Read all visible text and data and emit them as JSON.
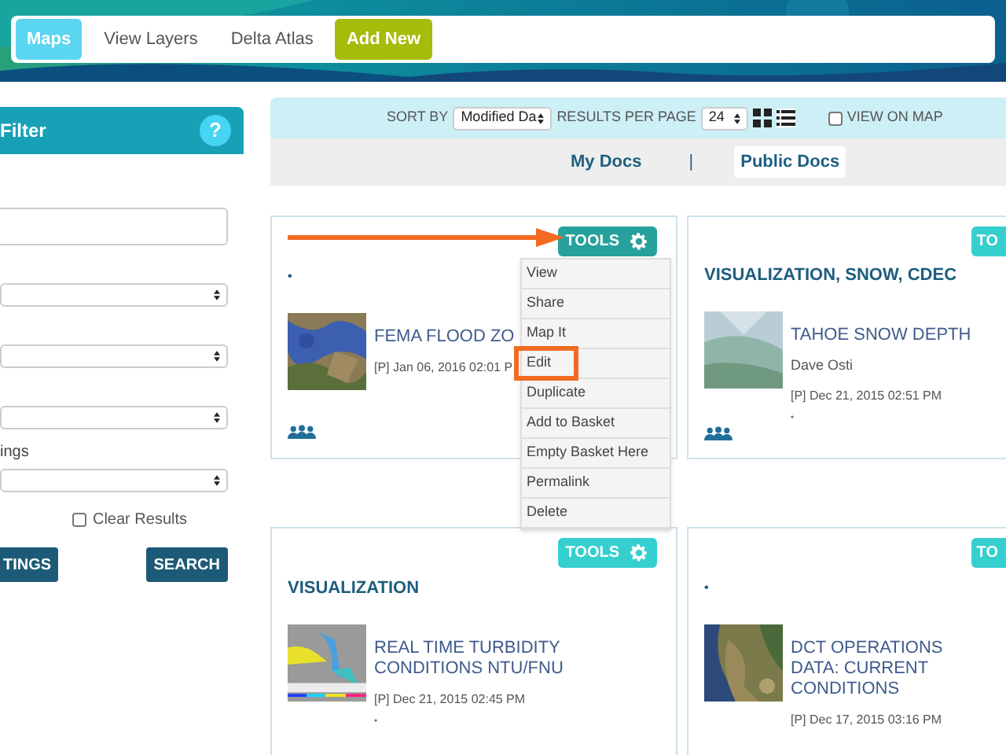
{
  "nav": [
    {
      "label": "Maps",
      "kind": "tab",
      "selected": true
    },
    {
      "label": "View Layers",
      "kind": "tab",
      "selected": false
    },
    {
      "label": "Delta Atlas",
      "kind": "tab",
      "selected": false
    },
    {
      "label": "Add New",
      "kind": "action",
      "selected": false
    }
  ],
  "filter": {
    "title": "Filter",
    "help": "?",
    "fields": [
      {
        "kind": "input"
      },
      {
        "kind": "select"
      },
      {
        "kind": "select"
      },
      {
        "kind": "select"
      },
      {
        "kind": "label",
        "text": "ings"
      },
      {
        "kind": "select"
      }
    ],
    "clear_results": {
      "label": "Clear Results",
      "checked": false
    },
    "buttons": [
      "TINGS",
      "SEARCH"
    ]
  },
  "toolbar": {
    "sort_label": "SORT BY",
    "sort_value": "Modified Da",
    "per_page_label": "RESULTS PER PAGE",
    "per_page_value": "24",
    "view_on_map": {
      "label": "VIEW ON MAP",
      "checked": false
    }
  },
  "doc_tabs": [
    {
      "label": "My Docs",
      "selected": false
    },
    {
      "label": "Public Docs",
      "selected": true
    }
  ],
  "doc_tab_separator": "|",
  "cards": [
    {
      "tags": "•",
      "title": "FEMA FLOOD ZO",
      "date": "[P] Jan 06, 2016 02:01 P",
      "group_icon": true,
      "pointer_arrow": true,
      "tools": {
        "label": "TOOLS",
        "gear": true,
        "active": true
      }
    },
    {
      "tags": "VISUALIZATION, SNOW, CDEC",
      "title": "TAHOE SNOW DEPTH",
      "author": "Dave Osti",
      "date": "[P] Dec 21, 2015 02:51 PM",
      "note": "•",
      "group_icon": true,
      "pointer_arrow": false,
      "tools": {
        "label": "TO",
        "gear": false,
        "active": false
      }
    },
    {
      "tags": "VISUALIZATION",
      "title": "REAL TIME TURBIDITY CONDITIONS NTU/FNU",
      "date": "[P] Dec 21, 2015 02:45 PM",
      "note": "•",
      "group_icon": false,
      "pointer_arrow": false,
      "tools": {
        "label": "TOOLS",
        "gear": true,
        "active": false
      }
    },
    {
      "tags": "•",
      "title": "DCT OPERATIONS DATA: CURRENT CONDITIONS",
      "date": "[P] Dec 17, 2015 03:16 PM",
      "group_icon": false,
      "pointer_arrow": false,
      "tools": {
        "label": "TO",
        "gear": false,
        "active": false
      }
    }
  ],
  "tools_menu": [
    {
      "label": "View",
      "highlighted": false
    },
    {
      "label": "Share",
      "highlighted": false
    },
    {
      "label": "Map It",
      "highlighted": false
    },
    {
      "label": "Edit",
      "highlighted": true
    },
    {
      "label": "Duplicate",
      "highlighted": false
    },
    {
      "label": "Add to Basket",
      "highlighted": false
    },
    {
      "label": "Empty Basket Here",
      "highlighted": false
    },
    {
      "label": "Permalink",
      "highlighted": false
    },
    {
      "label": "Delete",
      "highlighted": false
    }
  ]
}
